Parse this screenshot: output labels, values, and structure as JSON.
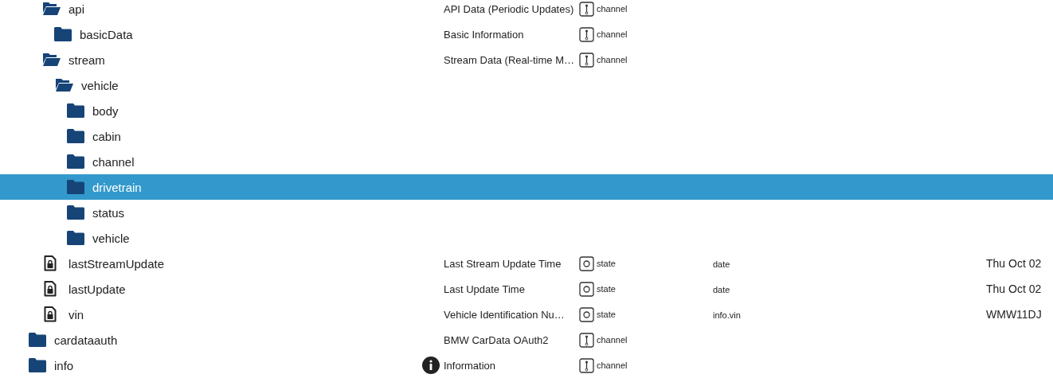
{
  "tree": [
    {
      "children": [
        {
          "name": "api",
          "kind": "folder",
          "expanded": true,
          "selected": false,
          "description": "API Data (Periodic Updates)",
          "type": "channel",
          "children": [
            {
              "name": "basicData",
              "kind": "folder",
              "expanded": false,
              "selected": false,
              "description": "Basic Information",
              "type": "channel"
            }
          ]
        },
        {
          "name": "stream",
          "kind": "folder",
          "expanded": true,
          "selected": false,
          "description": "Stream Data (Real-time M…",
          "type": "channel",
          "children": [
            {
              "name": "vehicle",
              "kind": "folder",
              "expanded": true,
              "selected": false,
              "children": [
                {
                  "name": "body",
                  "kind": "folder",
                  "expanded": false,
                  "selected": false
                },
                {
                  "name": "cabin",
                  "kind": "folder",
                  "expanded": false,
                  "selected": false
                },
                {
                  "name": "channel",
                  "kind": "folder",
                  "expanded": false,
                  "selected": false
                },
                {
                  "name": "drivetrain",
                  "kind": "folder",
                  "expanded": false,
                  "selected": true
                },
                {
                  "name": "status",
                  "kind": "folder",
                  "expanded": false,
                  "selected": false
                },
                {
                  "name": "vehicle",
                  "kind": "folder",
                  "expanded": false,
                  "selected": false
                }
              ]
            }
          ]
        },
        {
          "name": "lastStreamUpdate",
          "kind": "state",
          "selected": false,
          "description": "Last Stream Update Time",
          "type": "state",
          "role": "date",
          "value": "Thu Oct 02"
        },
        {
          "name": "lastUpdate",
          "kind": "state",
          "selected": false,
          "description": "Last Update Time",
          "type": "state",
          "role": "date",
          "value": "Thu Oct 02"
        },
        {
          "name": "vin",
          "kind": "state",
          "selected": false,
          "description": "Vehicle Identification Nu…",
          "type": "state",
          "role": "info.vin",
          "value": "WMW11DJ"
        }
      ]
    },
    {
      "name": "cardataauth",
      "kind": "folder",
      "expanded": false,
      "selected": false,
      "description": "BMW CarData OAuth2",
      "type": "channel"
    },
    {
      "name": "info",
      "kind": "folder",
      "expanded": false,
      "selected": false,
      "info_icon": true,
      "description": "Information",
      "type": "channel"
    }
  ]
}
